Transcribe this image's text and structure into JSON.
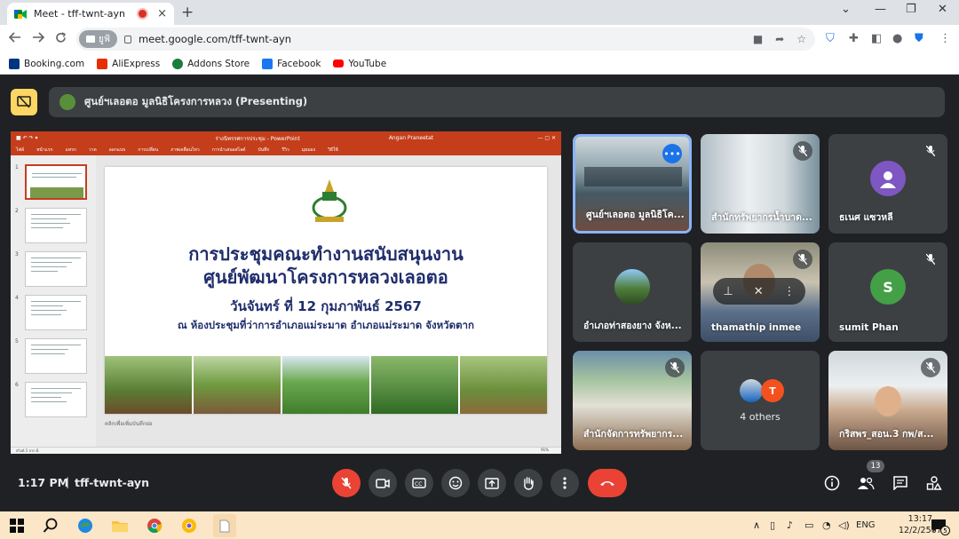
{
  "browser": {
    "tab_title": "Meet - tff-twnt-ayn",
    "new_tab": "+",
    "close_tab": "×",
    "win_min": "⌄",
    "win_minimize": "—",
    "win_restore": "❐",
    "win_close": "✕",
    "lang_chip": "ยูฟ้",
    "url": "meet.google.com/tff-twnt-ayn",
    "bookmarks": [
      {
        "label": "Booking.com",
        "color": "#003580"
      },
      {
        "label": "AliExpress",
        "color": "#e62e04"
      },
      {
        "label": "Addons Store",
        "color": "#1b7d3a"
      },
      {
        "label": "Facebook",
        "color": "#1877f2"
      },
      {
        "label": "YouTube",
        "color": "#ff0000"
      }
    ]
  },
  "meet": {
    "presenting_label": "ศูนย์ฯเลอตอ มูลนิธิโครงการหลวง (Presenting)",
    "slide": {
      "ppt_app_title": "ร่างนิทรรศการประชุม - PowerPoint",
      "ppt_user": "Angan Praneetat",
      "ribbon": [
        "ไฟล์",
        "หน้าแรก",
        "แทรก",
        "วาด",
        "ออกแบบ",
        "การเปลี่ยน",
        "ภาพเคลื่อนไหว",
        "การนำเสนอสไลด์",
        "บันทึก",
        "รีวิว",
        "มุมมอง",
        "วิธีใช้"
      ],
      "title_line1": "การประชุมคณะทำงานสนับสนุนงาน",
      "title_line2": "ศูนย์พัฒนาโครงการหลวงเลอตอ",
      "date_line": "วันจันทร์ ที่  12  กุมภาพันธ์  2567",
      "location_line": "ณ ห้องประชุมที่ว่าการอำเภอแม่ระมาด  อำเภอแม่ระมาด จังหวัดตาก",
      "notes_placeholder": "คลิกเพื่อเพิ่มบันทึกย่อ",
      "status_left": "สไลด์ 1 จาก 6",
      "status_zoom": "91%",
      "thumb_numbers": [
        "1",
        "2",
        "3",
        "4",
        "5",
        "6"
      ]
    },
    "participants": [
      {
        "name": "ศูนย์ฯเลอตอ มูลนิธิโค...",
        "type": "video",
        "active": true
      },
      {
        "name": "สำนักทรัพยากรน้ำบาด...",
        "type": "video"
      },
      {
        "name": "ธเนศ แซวหลี",
        "type": "avatar",
        "initial": "",
        "color": "#7e57c2"
      },
      {
        "name": "อำเภอท่าสองยาง จังห...",
        "type": "video"
      },
      {
        "name": "thamathip inmee",
        "type": "video"
      },
      {
        "name": "sumit Phan",
        "type": "avatar",
        "initial": "S",
        "color": "#43a047"
      },
      {
        "name": "สำนักจัดการทรัพยากร...",
        "type": "video"
      },
      {
        "name": "กริสพร_สอน.3 กพ/ส...",
        "type": "video"
      }
    ],
    "others_label": "4 others",
    "others_initial": "T",
    "time": "1:17 PM",
    "separator": "|",
    "meeting_code": "tff-twnt-ayn",
    "people_count": "13"
  },
  "taskbar": {
    "lang": "ENG",
    "time": "13:17",
    "date": "12/2/2567",
    "notif_count": "5"
  }
}
